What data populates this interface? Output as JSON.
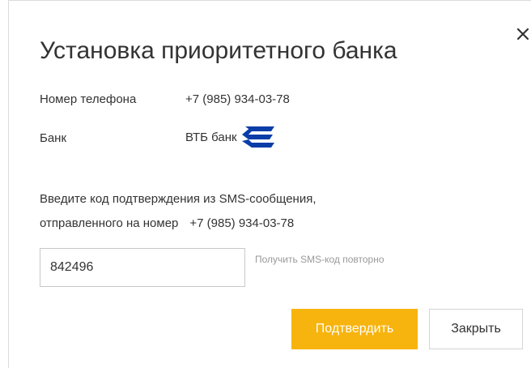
{
  "dialog": {
    "title": "Установка приоритетного банка",
    "close_icon": "close-icon",
    "phone_label": "Номер телефона",
    "phone_value": "+7 (985) 934-03-78",
    "bank_label": "Банк",
    "bank_value": "ВТБ банк",
    "bank_logo_icon": "vtb-logo-icon",
    "instruction_line1": "Введите код подтверждения из SMS-сообщения,",
    "instruction_line2": "отправленного на номер",
    "instruction_phone": "+7 (985) 934-03-78",
    "code_value": "842496",
    "resend_link": "Получить SMS-код повторно",
    "confirm_button": "Подтвердить",
    "close_button": "Закрыть"
  },
  "colors": {
    "accent": "#f7b40e",
    "vtb_blue": "#0a3da8",
    "muted_text": "#999999"
  }
}
